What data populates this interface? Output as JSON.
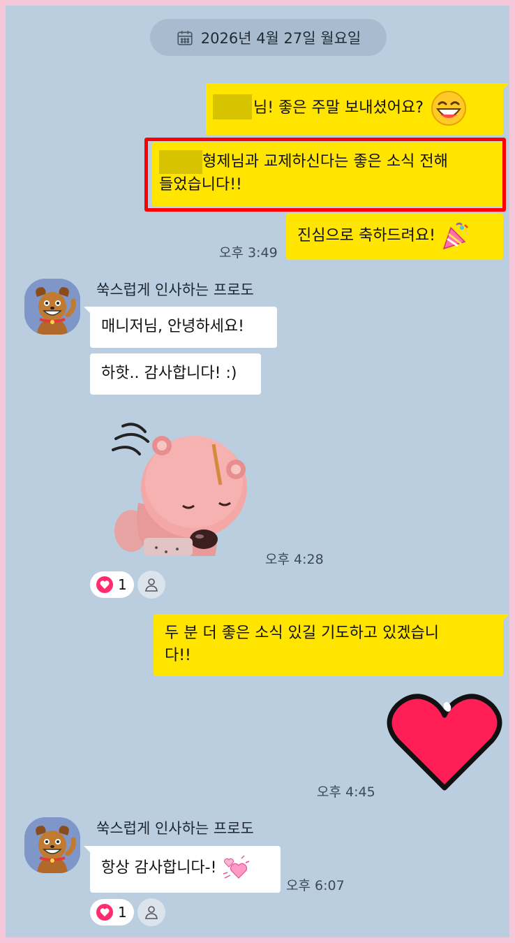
{
  "date_header": {
    "label": "2026년 4월 27일 월요일",
    "icon": "calendar-icon"
  },
  "messages_me_1": {
    "line1_suffix": "님! 좋은 주말 보내셨어요?",
    "line2_a": "형제님과 교제하신다는 좋은 소식 전해",
    "line2_b": "들었습니다!!",
    "line3": "진심으로 축하드려요!",
    "time": "오후 3:49"
  },
  "group_frodo_1": {
    "sender": "쑥스럽게 인사하는 프로도",
    "msg1": "매니저님, 안녕하세요!",
    "msg2": "하핫.. 감사합니다! :)",
    "time": "오후 4:28",
    "reaction_count": "1"
  },
  "messages_me_2": {
    "line_a": "두 분 더 좋은 소식 있길 기도하고 있겠습니",
    "line_b": "다!!",
    "time": "오후 4:45"
  },
  "group_frodo_2": {
    "sender": "쑥스럽게 인사하는 프로도",
    "msg1": "항상 감사합니다-!",
    "time": "오후 6:07",
    "reaction_count": "1"
  },
  "colors": {
    "chat_bg": "#bacee0",
    "my_bubble": "#ffe500",
    "other_bubble": "#ffffff",
    "highlight_border": "#ff0000",
    "heart": "#ff1e56"
  }
}
